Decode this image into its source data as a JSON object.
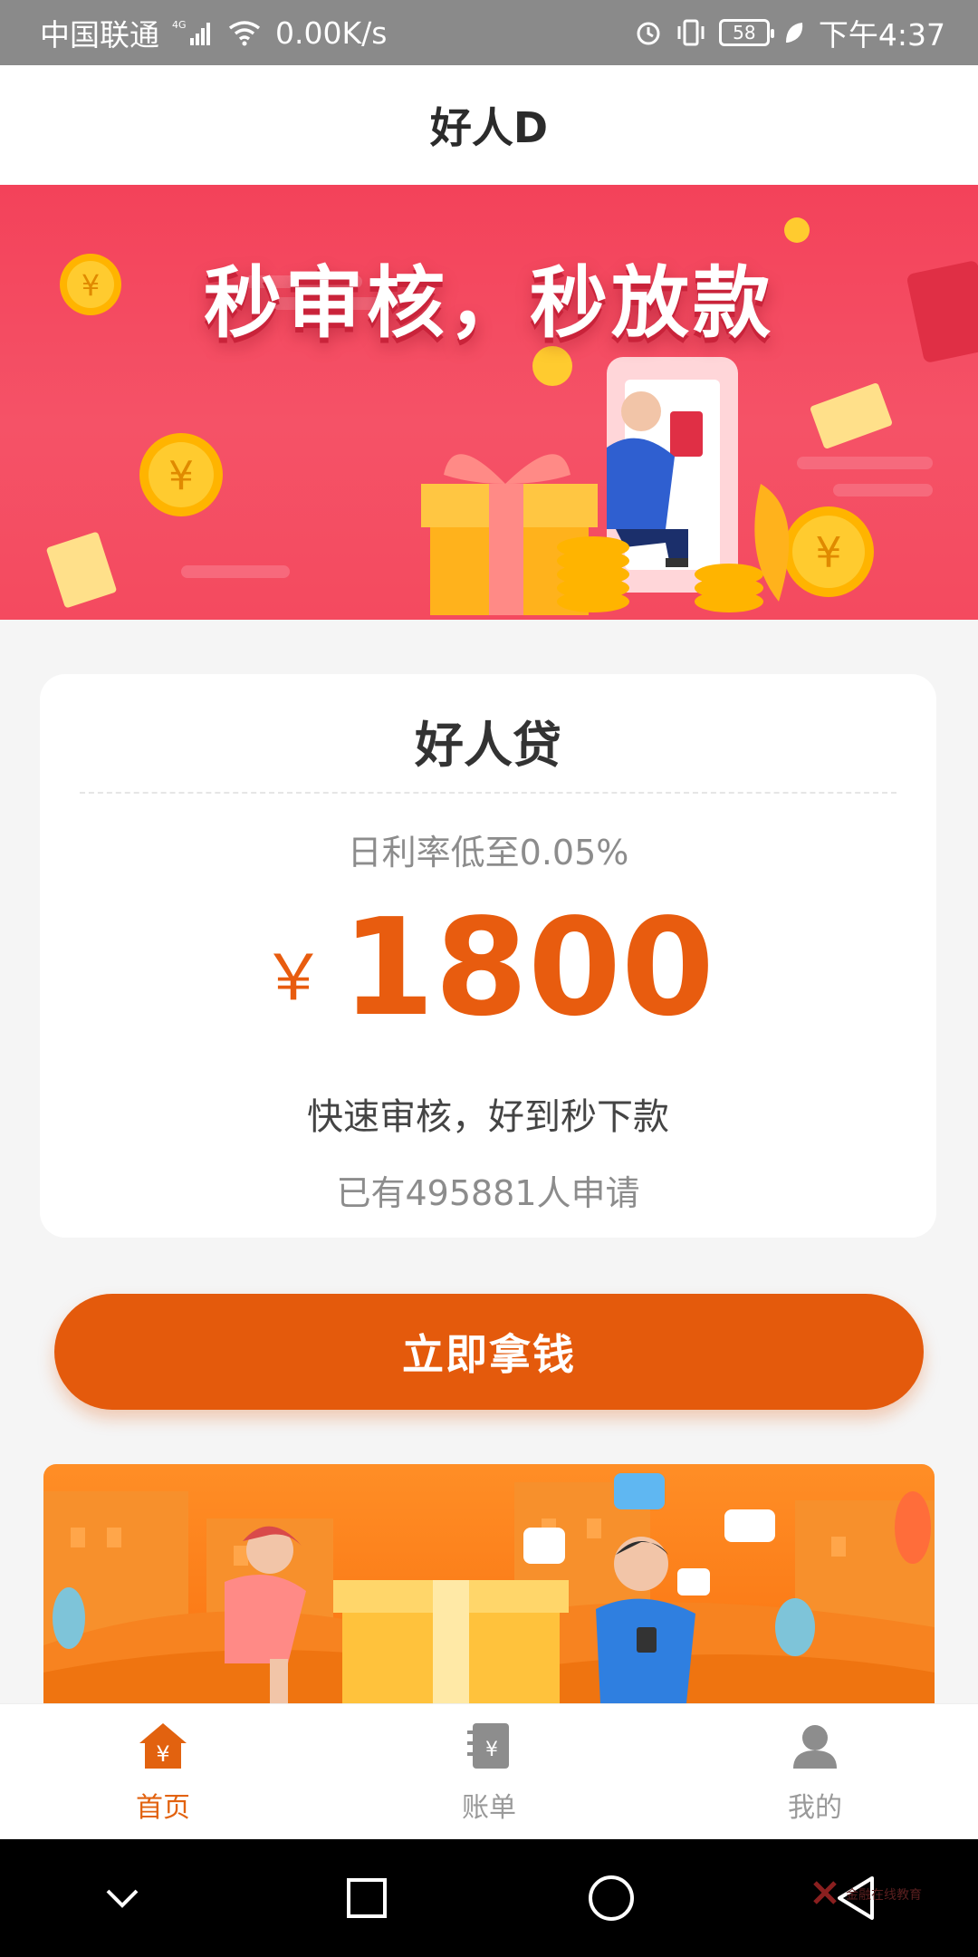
{
  "status_bar": {
    "carrier": "中国联通",
    "network": "4G",
    "speed": "0.00K/s",
    "battery": "58",
    "time": "下午4:37"
  },
  "app": {
    "title": "好人D"
  },
  "banner": {
    "headline": "秒审核，秒放款"
  },
  "loan_card": {
    "title": "好人贷",
    "rate_text": "日利率低至0.05%",
    "currency": "￥",
    "amount": "1800",
    "tagline": "快速审核，好到秒下款",
    "applicants": "已有495881人申请"
  },
  "cta": {
    "label": "立即拿钱"
  },
  "bottom_nav": {
    "items": [
      {
        "label": "首页",
        "icon": "home-yen-icon",
        "active": true
      },
      {
        "label": "账单",
        "icon": "bill-icon",
        "active": false
      },
      {
        "label": "我的",
        "icon": "user-icon",
        "active": false
      }
    ]
  },
  "system_nav": {
    "buttons": [
      "collapse-icon",
      "recents-icon",
      "home-icon",
      "back-icon"
    ]
  },
  "watermark": {
    "text": "金融在线教育"
  },
  "colors": {
    "accent": "#e45a0c",
    "amount": "#e85c0f",
    "banner_bg": "#f3425a",
    "status_bar": "#8a8a8a"
  }
}
